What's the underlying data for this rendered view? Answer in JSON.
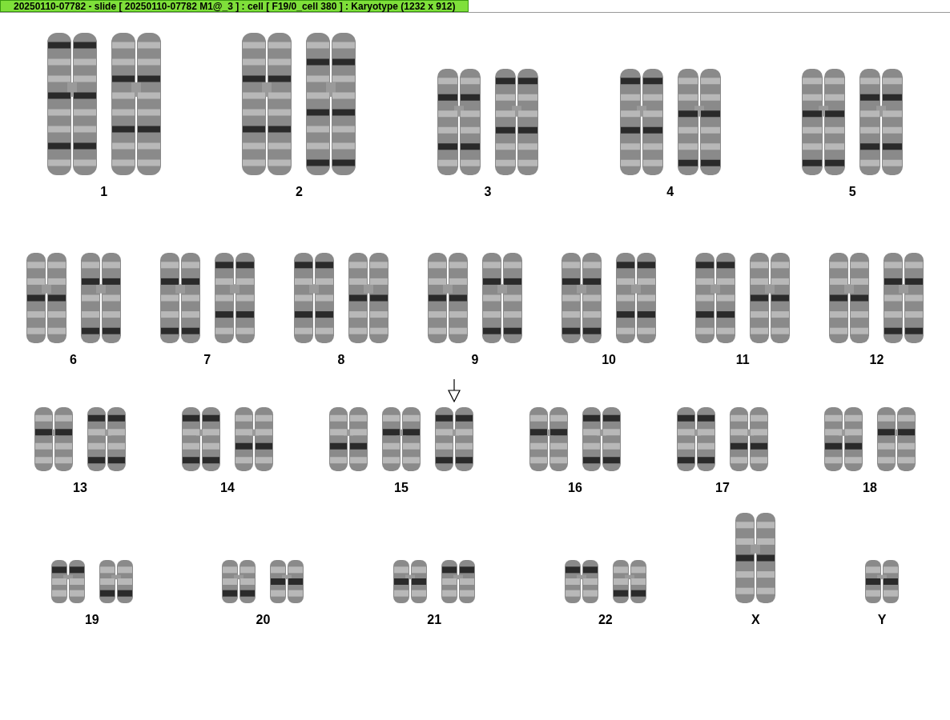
{
  "window": {
    "title": "20250110-07782 - slide [ 20250110-07782 M1@_3 ] : cell [ F19/0_cell 380 ] : Karyotype  (1232 x 912)"
  },
  "rows": [
    {
      "groups": [
        {
          "label": "1",
          "chromosomes": [
            {
              "kind": "xl",
              "marked": false
            },
            {
              "kind": "xl",
              "marked": false
            }
          ]
        },
        {
          "label": "2",
          "chromosomes": [
            {
              "kind": "xl",
              "marked": false
            },
            {
              "kind": "xl",
              "marked": false
            }
          ]
        },
        {
          "label": "3",
          "chromosomes": [
            {
              "kind": "l",
              "marked": false
            },
            {
              "kind": "l",
              "marked": false
            }
          ]
        },
        {
          "label": "4",
          "chromosomes": [
            {
              "kind": "l",
              "marked": false
            },
            {
              "kind": "l",
              "marked": false
            }
          ]
        },
        {
          "label": "5",
          "chromosomes": [
            {
              "kind": "l",
              "marked": false
            },
            {
              "kind": "l",
              "marked": false
            }
          ]
        }
      ]
    },
    {
      "groups": [
        {
          "label": "6",
          "chromosomes": [
            {
              "kind": "m",
              "marked": false
            },
            {
              "kind": "m",
              "marked": false
            }
          ]
        },
        {
          "label": "7",
          "chromosomes": [
            {
              "kind": "m",
              "marked": false
            },
            {
              "kind": "m",
              "marked": false
            }
          ]
        },
        {
          "label": "8",
          "chromosomes": [
            {
              "kind": "m",
              "marked": false
            },
            {
              "kind": "m",
              "marked": false
            }
          ]
        },
        {
          "label": "9",
          "chromosomes": [
            {
              "kind": "m",
              "marked": false
            },
            {
              "kind": "m",
              "marked": false
            }
          ]
        },
        {
          "label": "10",
          "chromosomes": [
            {
              "kind": "m",
              "marked": false
            },
            {
              "kind": "m",
              "marked": false
            }
          ]
        },
        {
          "label": "11",
          "chromosomes": [
            {
              "kind": "m",
              "marked": false
            },
            {
              "kind": "m",
              "marked": false
            }
          ]
        },
        {
          "label": "12",
          "chromosomes": [
            {
              "kind": "m",
              "marked": false
            },
            {
              "kind": "m",
              "marked": false
            }
          ]
        }
      ]
    },
    {
      "groups": [
        {
          "label": "13",
          "chromosomes": [
            {
              "kind": "s",
              "marked": false
            },
            {
              "kind": "s",
              "marked": false
            }
          ]
        },
        {
          "label": "14",
          "chromosomes": [
            {
              "kind": "s",
              "marked": false
            },
            {
              "kind": "s",
              "marked": false
            }
          ]
        },
        {
          "label": "15",
          "chromosomes": [
            {
              "kind": "s",
              "marked": false
            },
            {
              "kind": "s",
              "marked": false
            },
            {
              "kind": "s",
              "marked": true
            }
          ]
        },
        {
          "label": "16",
          "chromosomes": [
            {
              "kind": "s",
              "marked": false
            },
            {
              "kind": "s",
              "marked": false
            }
          ]
        },
        {
          "label": "17",
          "chromosomes": [
            {
              "kind": "s",
              "marked": false
            },
            {
              "kind": "s",
              "marked": false
            }
          ]
        },
        {
          "label": "18",
          "chromosomes": [
            {
              "kind": "s",
              "marked": false
            },
            {
              "kind": "s",
              "marked": false
            }
          ]
        }
      ]
    },
    {
      "groups": [
        {
          "label": "19",
          "chromosomes": [
            {
              "kind": "xs",
              "marked": false
            },
            {
              "kind": "xs",
              "marked": false
            }
          ]
        },
        {
          "label": "20",
          "chromosomes": [
            {
              "kind": "xs",
              "marked": false
            },
            {
              "kind": "xs",
              "marked": false
            }
          ]
        },
        {
          "label": "21",
          "chromosomes": [
            {
              "kind": "xs",
              "marked": false
            },
            {
              "kind": "xs",
              "marked": false
            }
          ]
        },
        {
          "label": "22",
          "chromosomes": [
            {
              "kind": "xs",
              "marked": false
            },
            {
              "kind": "xs",
              "marked": false
            }
          ]
        },
        {
          "label": "X",
          "chromosomes": [
            {
              "kind": "m",
              "marked": false
            }
          ]
        },
        {
          "label": "Y",
          "chromosomes": [
            {
              "kind": "xs",
              "marked": false
            }
          ]
        }
      ]
    }
  ]
}
